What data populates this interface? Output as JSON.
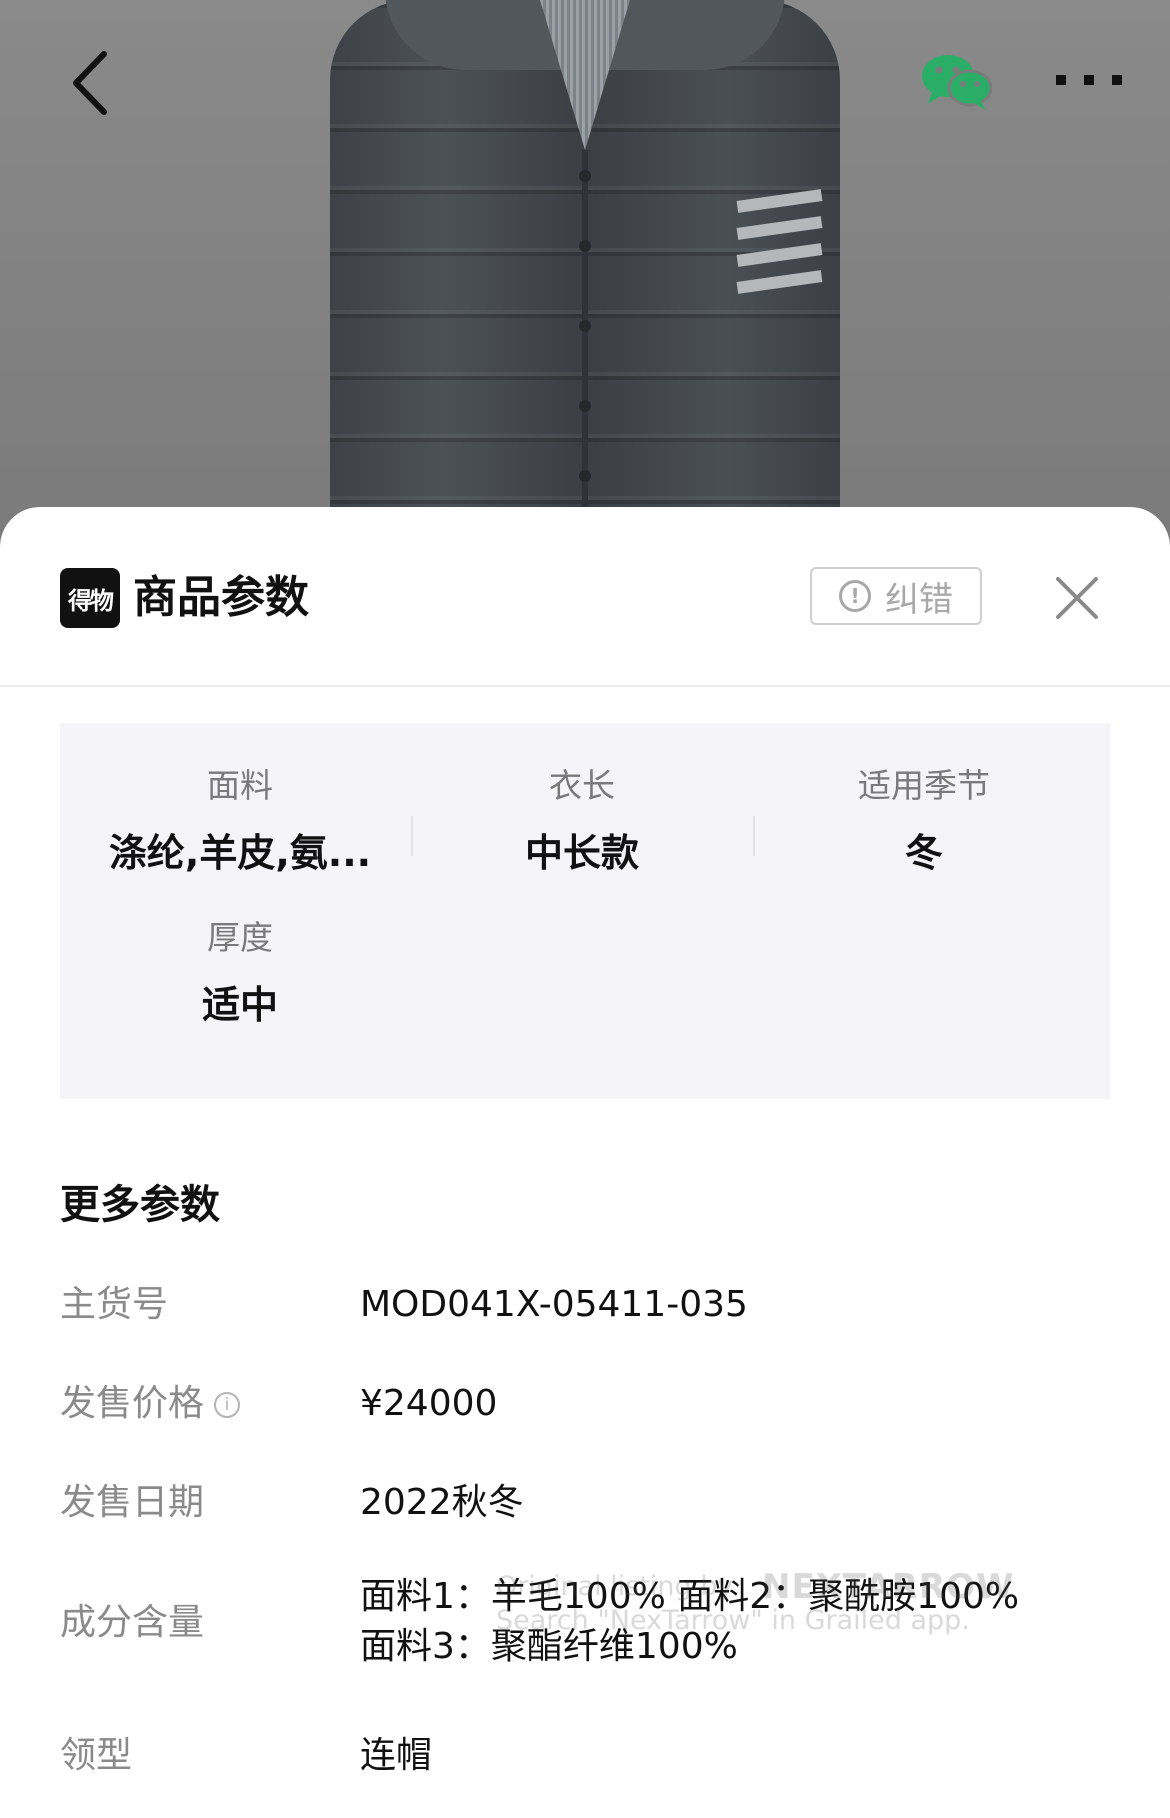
{
  "nav": {
    "back_icon": "chevron-left-icon",
    "share_icon": "wechat-icon",
    "more_icon": "more-dots-icon"
  },
  "sheet": {
    "logo_text": "得物",
    "title": "商品参数",
    "report_label": "纠错",
    "report_icon": "exclamation-circle-icon",
    "close_icon": "close-icon"
  },
  "params": [
    {
      "label": "面料",
      "value": "涤纶,羊皮,氨..."
    },
    {
      "label": "衣长",
      "value": "中长款"
    },
    {
      "label": "适用季节",
      "value": "冬"
    },
    {
      "label": "厚度",
      "value": "适中"
    }
  ],
  "more": {
    "title": "更多参数",
    "rows": [
      {
        "label": "主货号",
        "value": "MOD041X-05411-035"
      },
      {
        "label": "发售价格",
        "value": "¥24000"
      },
      {
        "label": "发售日期",
        "value": "2022秋冬"
      },
      {
        "label": "成分含量",
        "value_line1": "面料1：羊毛100% 面料2：聚酰胺100%",
        "value_line2": "面料3：聚酯纤维100%"
      },
      {
        "label": "领型",
        "value": "连帽"
      }
    ]
  },
  "watermark": {
    "line1": "Original listing by",
    "brand": "NEXTARROW",
    "line2": "Search \"NexTarrow\" in Grailed app."
  },
  "colors": {
    "sheet_bg": "#ffffff",
    "params_bg": "#f5f5f8",
    "label_gray": "#8a8a8a",
    "text_dark": "#111111",
    "wechat_green": "#2aae67"
  }
}
